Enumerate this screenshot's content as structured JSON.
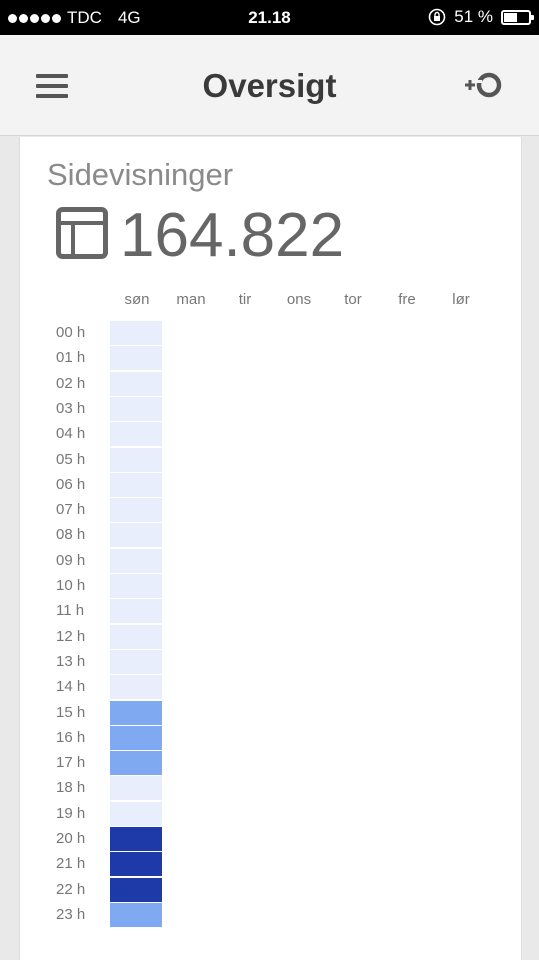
{
  "status_bar": {
    "carrier": "TDC",
    "network": "4G",
    "time": "21.18",
    "battery": "51 %",
    "battery_level": 0.51,
    "icons": [
      "signal-dots-icon",
      "rotation-lock-icon",
      "battery-icon"
    ]
  },
  "app_bar": {
    "title": "Oversigt",
    "icons": [
      "menu-icon",
      "add-segment-icon"
    ]
  },
  "card": {
    "title": "Sidevisninger",
    "value": "164.822",
    "icon": "table-icon"
  },
  "heatmap": {
    "days": [
      "søn",
      "man",
      "tir",
      "ons",
      "tor",
      "fre",
      "lør"
    ],
    "hours": [
      "00 h",
      "01 h",
      "02 h",
      "03 h",
      "04 h",
      "05 h",
      "06 h",
      "07 h",
      "08 h",
      "09 h",
      "10 h",
      "11 h",
      "12 h",
      "13 h",
      "14 h",
      "15 h",
      "16 h",
      "17 h",
      "18 h",
      "19 h",
      "20 h",
      "21 h",
      "22 h",
      "23 h"
    ],
    "colors": {
      "low": "#e8eefc",
      "medium": "#7faaf2",
      "high": "#1d3aa8"
    },
    "levels": {
      "søn": [
        "low",
        "low",
        "low",
        "low",
        "low",
        "low",
        "low",
        "low",
        "low",
        "low",
        "low",
        "low",
        "low",
        "low",
        "low",
        "medium",
        "medium",
        "medium",
        "low",
        "low",
        "high",
        "high",
        "high",
        "medium"
      ]
    }
  }
}
